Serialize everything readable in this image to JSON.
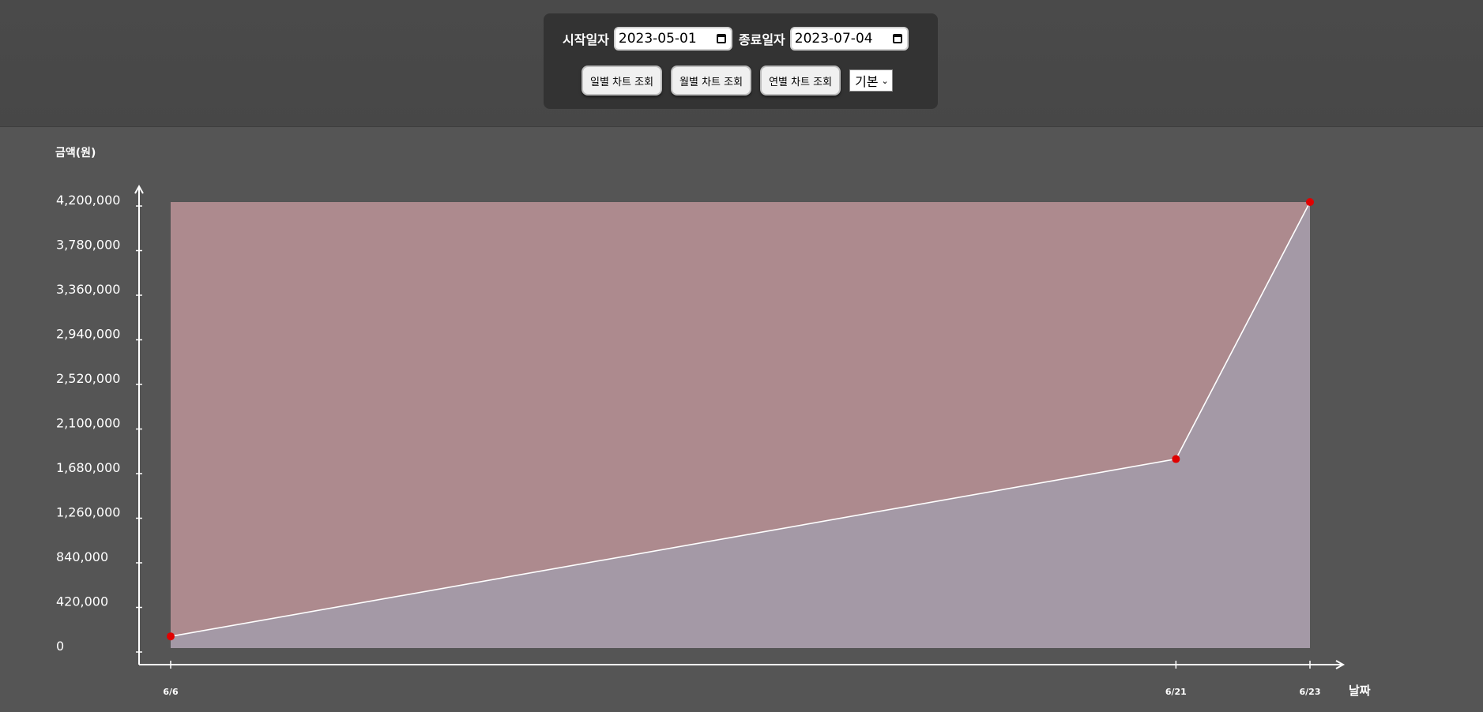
{
  "filter": {
    "start_label": "시작일자",
    "start_date": "2023-05-01",
    "end_label": "종료일자",
    "end_date": "2023-07-04",
    "daily_button": "일별 차트 조회",
    "monthly_button": "월별 차트 조회",
    "yearly_button": "연별 차트 조회",
    "mode_select": "기본"
  },
  "colors": {
    "background": "#555555",
    "upper_fill": "#ad8a8e",
    "lower_fill": "#a499a6",
    "line": "#ffffff",
    "point": "#e00000"
  },
  "chart_data": {
    "type": "area",
    "ylabel": "금액(원)",
    "xlabel": "날짜",
    "x": [
      "6/6",
      "6/21",
      "6/23"
    ],
    "values": [
      110000,
      1780000,
      4200000
    ],
    "ylim": [
      0,
      4200000
    ],
    "yticks": [
      "0",
      "420,000",
      "840,000",
      "1,260,000",
      "1,680,000",
      "2,100,000",
      "2,520,000",
      "2,940,000",
      "3,360,000",
      "3,780,000",
      "4,200,000"
    ],
    "grid": false,
    "legend": "none"
  }
}
